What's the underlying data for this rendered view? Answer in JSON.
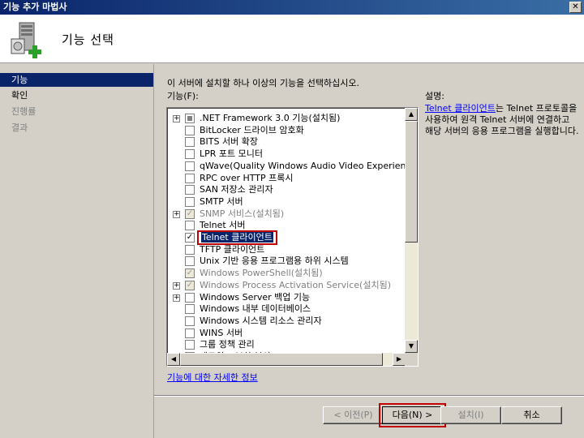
{
  "window": {
    "title": "기능 추가 마법사",
    "close_label": "✕"
  },
  "header": {
    "title": "기능 선택"
  },
  "nav": {
    "items": [
      {
        "label": "기능",
        "state": "active"
      },
      {
        "label": "확인",
        "state": "normal"
      },
      {
        "label": "진행률",
        "state": "disabled"
      },
      {
        "label": "결과",
        "state": "disabled"
      }
    ]
  },
  "main": {
    "instruction": "이 서버에 설치할 하나 이상의 기능을 선택하십시오.",
    "features_label": "기능(F):",
    "features": [
      {
        "label": ".NET Framework 3.0 기능(설치됨)",
        "expandable": true,
        "check": "partial",
        "grey": false
      },
      {
        "label": "BitLocker 드라이브 암호화",
        "expandable": false,
        "check": "none",
        "grey": false
      },
      {
        "label": "BITS 서버 확장",
        "expandable": false,
        "check": "none",
        "grey": false
      },
      {
        "label": "LPR 포트 모니터",
        "expandable": false,
        "check": "none",
        "grey": false
      },
      {
        "label": "qWave(Quality Windows Audio Video Experience)",
        "expandable": false,
        "check": "none",
        "grey": false
      },
      {
        "label": "RPC over HTTP 프록시",
        "expandable": false,
        "check": "none",
        "grey": false
      },
      {
        "label": "SAN 저장소 관리자",
        "expandable": false,
        "check": "none",
        "grey": false
      },
      {
        "label": "SMTP 서버",
        "expandable": false,
        "check": "none",
        "grey": false
      },
      {
        "label": "SNMP 서비스(설치됨)",
        "expandable": true,
        "check": "disabled",
        "grey": true
      },
      {
        "label": "Telnet 서버",
        "expandable": false,
        "check": "none",
        "grey": false
      },
      {
        "label": "Telnet 클라이언트",
        "expandable": false,
        "check": "checked",
        "grey": false,
        "selected": true
      },
      {
        "label": "TFTP 클라이언트",
        "expandable": false,
        "check": "none",
        "grey": false
      },
      {
        "label": "Unix 기반 응용 프로그램용 하위 시스템",
        "expandable": false,
        "check": "none",
        "grey": false
      },
      {
        "label": "Windows PowerShell(설치됨)",
        "expandable": false,
        "check": "disabled",
        "grey": true
      },
      {
        "label": "Windows Process Activation Service(설치됨)",
        "expandable": true,
        "check": "disabled",
        "grey": true
      },
      {
        "label": "Windows Server 백업 기능",
        "expandable": true,
        "check": "none",
        "grey": false
      },
      {
        "label": "Windows 내부 데이터베이스",
        "expandable": false,
        "check": "none",
        "grey": false
      },
      {
        "label": "Windows 시스템 리소스 관리자",
        "expandable": false,
        "check": "none",
        "grey": false
      },
      {
        "label": "WINS 서버",
        "expandable": false,
        "check": "none",
        "grey": false
      },
      {
        "label": "그룹 정책 관리",
        "expandable": false,
        "check": "none",
        "grey": false
      },
      {
        "label": "네트워크 부하 분산",
        "expandable": false,
        "check": "none",
        "grey": false
      }
    ],
    "description_label": "설명:",
    "description_link": "Telnet 클라이언트",
    "description_text": "는 Telnet 프로토콜을 사용하여 원격 Telnet 서버에 연결하고 해당 서버의 응용 프로그램을 실행합니다.",
    "more_info_link": "기능에 대한 자세한 정보"
  },
  "footer": {
    "prev_label": "< 이전(P)",
    "next_label": "다음(N) >",
    "install_label": "설치(I)",
    "cancel_label": "취소"
  }
}
